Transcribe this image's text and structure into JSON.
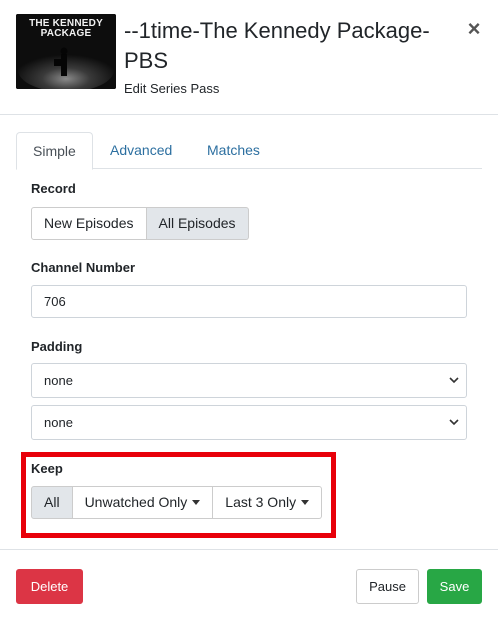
{
  "header": {
    "thumbnail_text_line1": "THE KENNEDY",
    "thumbnail_text_line2": "PACKAGE",
    "title": "--1time-The Kennedy Package-PBS",
    "subtitle": "Edit Series Pass",
    "close_glyph": "×"
  },
  "tabs": [
    {
      "label": "Simple",
      "active": true
    },
    {
      "label": "Advanced",
      "active": false
    },
    {
      "label": "Matches",
      "active": false
    }
  ],
  "record": {
    "label": "Record",
    "options": [
      "New Episodes",
      "All Episodes"
    ],
    "selected": "All Episodes"
  },
  "channel": {
    "label": "Channel Number",
    "value": "706"
  },
  "padding": {
    "label": "Padding",
    "start_value": "none",
    "end_value": "none"
  },
  "keep": {
    "label": "Keep",
    "all_label": "All",
    "unwatched_label": "Unwatched Only",
    "last_label": "Last 3 Only",
    "selected": "All"
  },
  "footer": {
    "delete_label": "Delete",
    "pause_label": "Pause",
    "save_label": "Save"
  },
  "colors": {
    "link": "#2c6fa0",
    "danger": "#dc3545",
    "success": "#28a745",
    "highlight": "#e8000a"
  }
}
